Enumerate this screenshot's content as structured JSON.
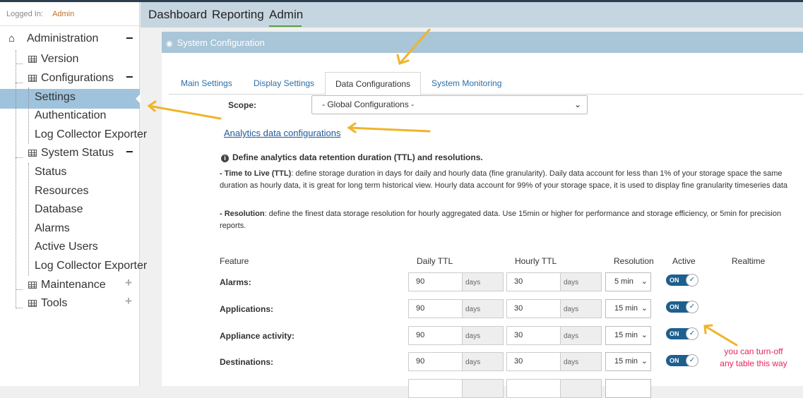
{
  "session": {
    "logged_in_label": "Logged In:",
    "user": "Admin"
  },
  "sidebar": {
    "administration": "Administration",
    "version": "Version",
    "configurations": "Configurations",
    "settings": "Settings",
    "authentication": "Authentication",
    "log_collector_exporter_1": "Log Collector Exporter",
    "system_status": "System Status",
    "status": "Status",
    "resources": "Resources",
    "database": "Database",
    "alarms": "Alarms",
    "active_users": "Active Users",
    "log_collector_exporter_2": "Log Collector Exporter",
    "maintenance": "Maintenance",
    "tools": "Tools",
    "minus_glyph": "−",
    "plus_glyph": "+"
  },
  "topnav": {
    "dashboard": "Dashboard",
    "reporting": "Reporting",
    "admin": "Admin",
    "active": "Admin"
  },
  "panel": {
    "title": "System Configuration",
    "tabs": [
      "Main Settings",
      "Display Settings",
      "Data Configurations",
      "System Monitoring"
    ],
    "active_tab": "Data Configurations",
    "scope_label": "Scope:",
    "scope_value": "- Global Configurations -",
    "analytics_link": "Analytics data configurations",
    "heading": "Define analytics data retention duration (TTL) and resolutions.",
    "ttl_term": "- Time to Live (TTL)",
    "ttl_text": ": define storage duration in days for daily and hourly data (fine granularity). Daily data account for less than 1% of your storage space the same duration as hourly data, it is great for long term historical view. Hourly data account for 99% of your storage space, it is used to display fine granularity timeseries data",
    "res_term": "- Resolution",
    "res_text": ": define the finest data storage resolution for hourly aggregated data. Use 15min or higher for performance and storage efficiency, or 5min for precision reports."
  },
  "table": {
    "headers": {
      "feature": "Feature",
      "daily_ttl": "Daily TTL",
      "hourly_ttl": "Hourly TTL",
      "resolution": "Resolution",
      "active": "Active",
      "realtime": "Realtime"
    },
    "unit": "days",
    "toggle_label": "ON",
    "rows": [
      {
        "feature": "Alarms:",
        "daily": "90",
        "hourly": "30",
        "resolution": "5 min",
        "active": true
      },
      {
        "feature": "Applications:",
        "daily": "90",
        "hourly": "30",
        "resolution": "15 min",
        "active": true
      },
      {
        "feature": "Appliance activity:",
        "daily": "90",
        "hourly": "30",
        "resolution": "15 min",
        "active": true
      },
      {
        "feature": "Destinations:",
        "daily": "90",
        "hourly": "30",
        "resolution": "15 min",
        "active": true
      }
    ]
  },
  "annotation": {
    "line1": "you can turn-off",
    "line2": "any table this way",
    "color": "#e8245a",
    "arrow_color": "#f0b429"
  },
  "colors": {
    "accent": "#1d5f8e",
    "header_bar": "#a9c5d8",
    "selected_nav": "#9fc3dc",
    "link": "#1f5a96"
  }
}
